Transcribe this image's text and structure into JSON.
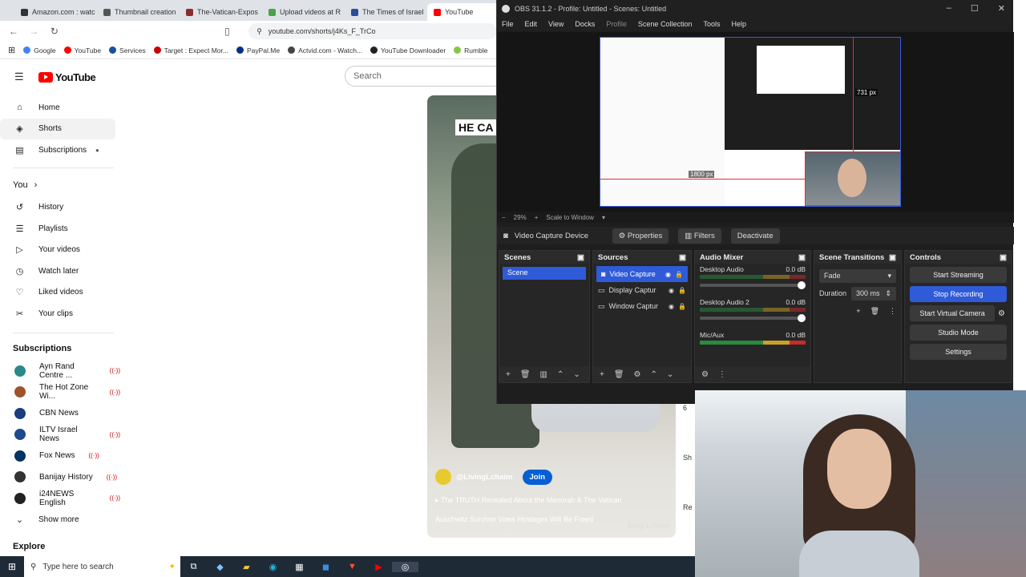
{
  "browser": {
    "tabs": [
      {
        "label": "Amazon.com : watc",
        "color": "#333333"
      },
      {
        "label": "Thumbnail creation",
        "color": "#555555"
      },
      {
        "label": "The-Vatican-Expos",
        "color": "#8b2d2d"
      },
      {
        "label": "Upload videos at R",
        "color": "#49a349"
      },
      {
        "label": "The Times of Israel",
        "color": "#2b4d9a"
      },
      {
        "label": "YouTube",
        "color": "#ff0000"
      }
    ],
    "url": "youtube.com/shorts/j4Ks_F_TrCo",
    "bookmarks": [
      {
        "label": "Google",
        "color": "#4285f4"
      },
      {
        "label": "YouTube",
        "color": "#ff0000"
      },
      {
        "label": "Services",
        "color": "#1a4fa0"
      },
      {
        "label": "Target : Expect Mor...",
        "color": "#cc0000"
      },
      {
        "label": "PayPal.Me",
        "color": "#003087"
      },
      {
        "label": "Actvid.com - Watch...",
        "color": "#444444"
      },
      {
        "label": "YouTube Downloader",
        "color": "#222222"
      },
      {
        "label": "Rumble",
        "color": "#85c742"
      }
    ]
  },
  "youtube": {
    "search_placeholder": "Search",
    "nav": [
      {
        "label": "Home",
        "icon": "home-icon",
        "glyph": "⌂"
      },
      {
        "label": "Shorts",
        "icon": "shorts-icon",
        "glyph": "◈"
      },
      {
        "label": "Subscriptions",
        "icon": "subscriptions-icon",
        "glyph": "▤"
      }
    ],
    "you_label": "You",
    "you_items": [
      {
        "label": "History",
        "icon": "history-icon",
        "glyph": "↺"
      },
      {
        "label": "Playlists",
        "icon": "playlists-icon",
        "glyph": "☰"
      },
      {
        "label": "Your videos",
        "icon": "your-videos-icon",
        "glyph": "▷"
      },
      {
        "label": "Watch later",
        "icon": "watch-later-icon",
        "glyph": "◷"
      },
      {
        "label": "Liked videos",
        "icon": "liked-icon",
        "glyph": "♡"
      },
      {
        "label": "Your clips",
        "icon": "clips-icon",
        "glyph": "✂"
      }
    ],
    "subscriptions_label": "Subscriptions",
    "subscriptions": [
      {
        "label": "Ayn Rand Centre ...",
        "color": "#2a8a8a"
      },
      {
        "label": "The Hot Zone Wi...",
        "color": "#a0522d"
      },
      {
        "label": "CBN News",
        "color": "#1a3d7c"
      },
      {
        "label": "ILTV Israel News",
        "color": "#1c4a8c"
      },
      {
        "label": "Fox News",
        "color": "#003366"
      },
      {
        "label": "Banijay History",
        "color": "#333333"
      },
      {
        "label": "i24NEWS English",
        "color": "#222222"
      }
    ],
    "show_more": "Show more",
    "explore": "Explore",
    "short": {
      "overlay_title": "HE CA",
      "channel": "@LivingLchaim",
      "join": "Join",
      "line1": "The TRUTH Revealed About the Menorah & The Vatican",
      "line2": "Auschwitz Survivor Vows Hostages Will Be Freed",
      "watermark": "living Lchaim"
    },
    "right_col": [
      "6",
      "Sh",
      "Re"
    ]
  },
  "obs": {
    "title": "OBS 31.1.2 - Profile: Untitled - Scenes: Untitled",
    "menu": [
      "File",
      "Edit",
      "View",
      "Docks",
      "Profile",
      "Scene Collection",
      "Tools",
      "Help"
    ],
    "preview_labels": {
      "height": "731 px",
      "width": "1800 px"
    },
    "zoom": "29%",
    "scale_mode": "Scale to Window",
    "source_bar": {
      "source": "Video Capture Device",
      "properties": "Properties",
      "filters": "Filters",
      "deactivate": "Deactivate"
    },
    "scenes": {
      "title": "Scenes",
      "items": [
        "Scene"
      ]
    },
    "sources": {
      "title": "Sources",
      "items": [
        "Video Capture",
        "Display Captur",
        "Window Captur"
      ]
    },
    "mixer": {
      "title": "Audio Mixer",
      "channels": [
        {
          "name": "Desktop Audio",
          "db": "0.0 dB"
        },
        {
          "name": "Desktop Audio 2",
          "db": "0.0 dB"
        },
        {
          "name": "Mic/Aux",
          "db": "0.0 dB"
        }
      ]
    },
    "transitions": {
      "title": "Scene Transitions",
      "type": "Fade",
      "duration_label": "Duration",
      "duration_value": "300 ms"
    },
    "controls": {
      "title": "Controls",
      "buttons": [
        "Start Streaming",
        "Stop Recording",
        "Start Virtual Camera",
        "Studio Mode",
        "Settings"
      ]
    }
  },
  "taskbar": {
    "search_placeholder": "Type here to search"
  }
}
